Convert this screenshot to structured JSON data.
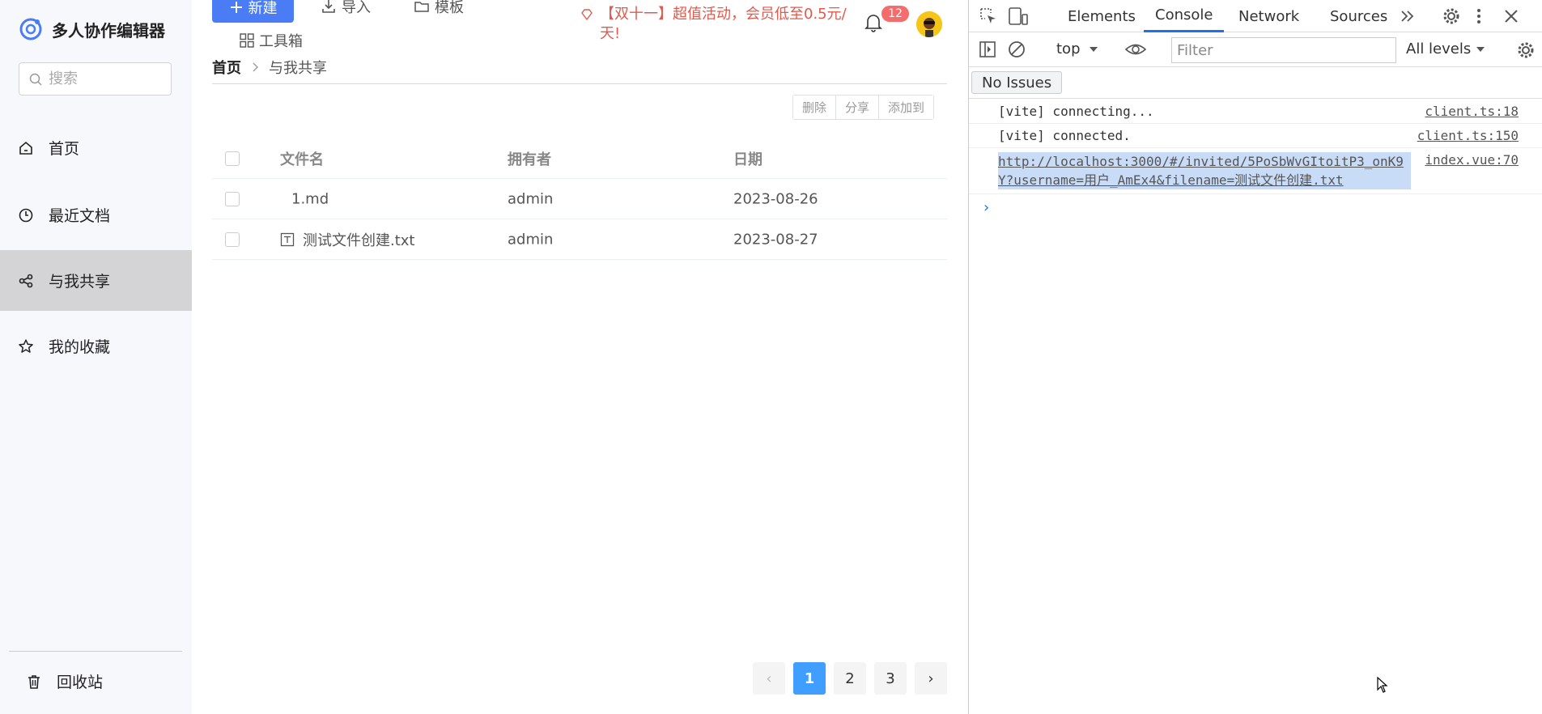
{
  "app": {
    "title": "多人协作编辑器",
    "search_placeholder": "搜索",
    "nav": [
      {
        "label": "首页",
        "icon": "home-icon"
      },
      {
        "label": "最近文档",
        "icon": "clock-icon"
      },
      {
        "label": "与我共享",
        "icon": "share-icon"
      },
      {
        "label": "我的收藏",
        "icon": "star-icon"
      }
    ],
    "trash_label": "回收站"
  },
  "toolbar": {
    "new_label": "新建",
    "import_label": "导入",
    "template_label": "模板",
    "toolbox_label": "工具箱",
    "promo": "【双十一】超值活动，会员低至0.5元/天!",
    "notifications": "12"
  },
  "breadcrumb": {
    "home": "首页",
    "current": "与我共享"
  },
  "actions": {
    "delete": "删除",
    "share": "分享",
    "add_to": "添加到"
  },
  "table": {
    "headers": {
      "name": "文件名",
      "owner": "拥有者",
      "date": "日期"
    },
    "rows": [
      {
        "name": "1.md",
        "owner": "admin",
        "date": "2023-08-26"
      },
      {
        "name": "测试文件创建.txt",
        "owner": "admin",
        "date": "2023-08-27"
      }
    ]
  },
  "pagination": {
    "pages": [
      "1",
      "2",
      "3"
    ],
    "current": "1",
    "prev": "‹",
    "next": "›"
  },
  "devtools": {
    "tabs": [
      "Elements",
      "Console",
      "Network",
      "Sources"
    ],
    "context": "top",
    "filter_placeholder": "Filter",
    "levels": "All levels",
    "issues": "No Issues",
    "logs": [
      {
        "text": "[vite] connecting...",
        "source": "client.ts:18"
      },
      {
        "text": "[vite] connected.",
        "source": "client.ts:150"
      },
      {
        "text": "http://localhost:3000/#/invited/5PoSbWvGItoitP3_onK9Y?username=用户_AmEx4&filename=测试文件创建.txt",
        "source": "index.vue:70"
      }
    ],
    "prompt": "›"
  },
  "colors": {
    "primary": "#4a7cf6",
    "promo": "#e05a4e",
    "badge": "#f56c6c",
    "page_active": "#409eff"
  }
}
